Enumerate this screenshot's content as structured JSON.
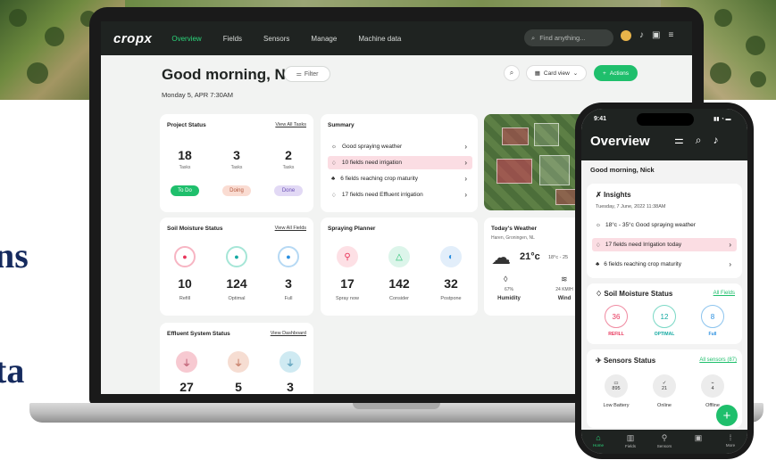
{
  "hero": {
    "line1": "ns",
    "line2": "ta"
  },
  "app": {
    "logo": "cropx",
    "nav": [
      "Overview",
      "Fields",
      "Sensors",
      "Manage",
      "Machine data"
    ],
    "search_placeholder": "Find anything...",
    "greeting": "Good morning, Nick",
    "filter_label": "Filter",
    "date": "Monday 5, APR 7:30AM",
    "card_view": "Card view",
    "actions": "Actions",
    "project_status": {
      "title": "Project Status",
      "link": "View All Tasks",
      "stats": [
        {
          "n": "18",
          "l": "Tasks"
        },
        {
          "n": "3",
          "l": "Tasks"
        },
        {
          "n": "2",
          "l": "Tasks"
        }
      ],
      "pills": [
        "To Do",
        "Doing",
        "Done"
      ]
    },
    "summary": {
      "title": "Summary",
      "rows": [
        "Good spraying weather",
        "10 fields need irrigation",
        "6 fields reaching crop maturity",
        "17 fields need Effluent irrigation"
      ]
    },
    "soil": {
      "title": "Soil Moisture Status",
      "link": "View All Fields",
      "stats": [
        {
          "n": "10",
          "l": "Refill"
        },
        {
          "n": "124",
          "l": "Optimal"
        },
        {
          "n": "3",
          "l": "Full"
        }
      ]
    },
    "spraying": {
      "title": "Spraying Planner",
      "stats": [
        {
          "n": "17",
          "l": "Spray now"
        },
        {
          "n": "142",
          "l": "Consider"
        },
        {
          "n": "32",
          "l": "Postpone"
        }
      ]
    },
    "weather": {
      "title": "Today's Weather",
      "location": "Haren, Groningen, NL",
      "temp": "21°c",
      "range": "18°c - 25",
      "humidity_val": "67%",
      "humidity_lbl": "Humidity",
      "wind_val": "24 KM/H",
      "wind_lbl": "Wind"
    },
    "effluent": {
      "title": "Effluent System Status",
      "link": "View Dashboard",
      "stats": [
        "27",
        "5",
        "3"
      ]
    }
  },
  "phone": {
    "time": "9:41",
    "title": "Overview",
    "greeting": "Good morning, Nick",
    "insights": {
      "title": "Insights",
      "date": "Tuesday, 7 June, 2022 11:38AM",
      "rows": [
        "18°c - 35°c Good spraying weather",
        "17 fields need Irrigation today",
        "6 fields reaching crop maturity"
      ]
    },
    "soil": {
      "title": "Soil Moisture Status",
      "link": "All Fields",
      "items": [
        {
          "n": "36",
          "l": "REFILL"
        },
        {
          "n": "12",
          "l": "OPTIMAL"
        },
        {
          "n": "8",
          "l": "Full"
        }
      ]
    },
    "sensors": {
      "title": "Sensors Status",
      "link": "All sensors (87)",
      "items": [
        {
          "n": "895",
          "l": "Low Battery"
        },
        {
          "n": "21",
          "l": "Online"
        },
        {
          "n": "4",
          "l": "Offline"
        }
      ]
    },
    "nav": [
      "Home",
      "Fields",
      "Sensors",
      "",
      "More"
    ]
  },
  "colors": {
    "brand_green": "#1fbf6c",
    "nav_dark": "#1f2321",
    "red": "#e8345a",
    "teal": "#13a9a1",
    "blue": "#2a8fe0"
  }
}
